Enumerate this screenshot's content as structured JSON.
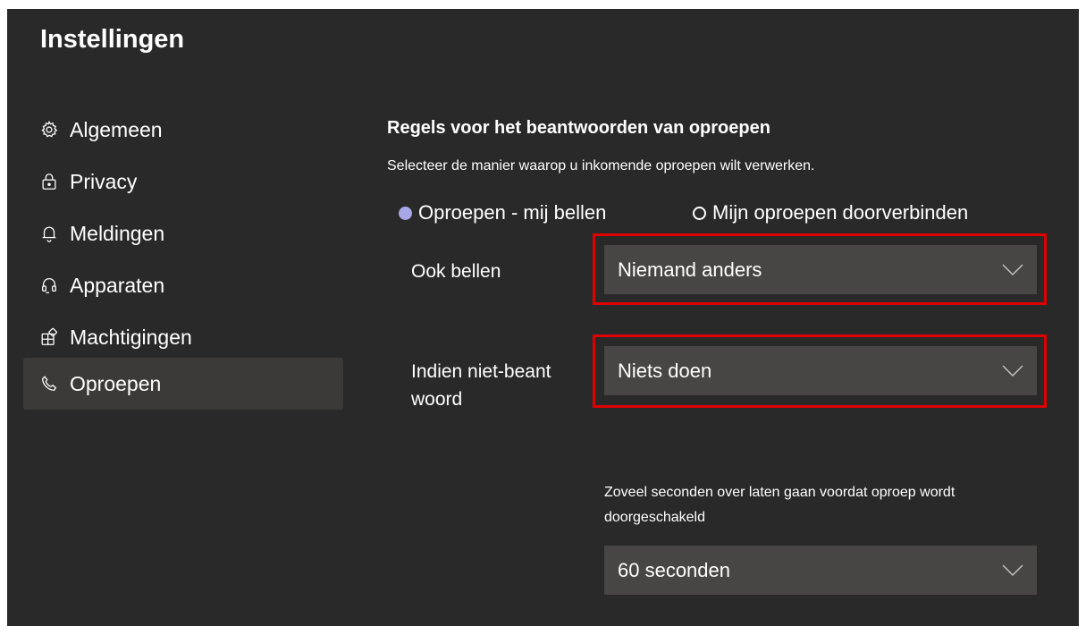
{
  "window": {
    "title": "Instellingen"
  },
  "sidebar": {
    "items": [
      {
        "label": "Algemeen",
        "icon": "gear-icon",
        "active": false
      },
      {
        "label": "Privacy",
        "icon": "lock-icon",
        "active": false
      },
      {
        "label": "Meldingen",
        "icon": "bell-icon",
        "active": false
      },
      {
        "label": "Apparaten",
        "icon": "headset-icon",
        "active": false
      },
      {
        "label": "Machtigingen",
        "icon": "permissions-icon",
        "active": false
      },
      {
        "label": "Oproepen",
        "icon": "phone-icon",
        "active": true
      }
    ]
  },
  "main": {
    "section_title": "Regels voor het beantwoorden van oproepen",
    "section_description": "Selecteer de manier waarop u inkomende oproepen wilt verwerken.",
    "radio_options": [
      {
        "label": "Oproepen - mij bellen",
        "checked": true
      },
      {
        "label": "Mijn oproepen doorverbinden",
        "checked": false
      }
    ],
    "also_ring": {
      "label": "Ook bellen",
      "value": "Niemand anders"
    },
    "if_unanswered": {
      "label_line1": "Indien niet-beant",
      "label_line2": "woord",
      "value": "Niets doen"
    },
    "forward_delay": {
      "help_text": "Zoveel seconden over laten gaan voordat oproep wordt doorgeschakeld",
      "value": "60 seconden"
    }
  },
  "colors": {
    "background": "#292929",
    "active_nav": "#3b3a39",
    "dropdown": "#484644",
    "radio_accent": "#a8a6e6",
    "highlight_border": "#e00000"
  }
}
